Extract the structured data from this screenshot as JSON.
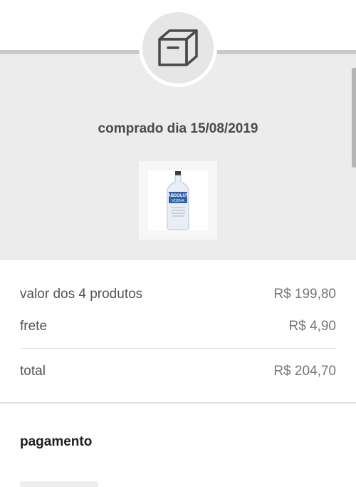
{
  "order": {
    "purchased_label": "comprado dia 15/08/2019",
    "product_image": "product-thumbnail",
    "product_brand": "ABSOLUT",
    "product_name": "VODKA"
  },
  "summary": {
    "products_label": "valor dos 4 produtos",
    "products_value": "R$ 199,80",
    "shipping_label": "frete",
    "shipping_value": "R$ 4,90",
    "total_label": "total",
    "total_value": "R$ 204,70"
  },
  "payment": {
    "title": "pagamento"
  },
  "icons": {
    "header_icon": "package-box-icon"
  },
  "colors": {
    "header_background": "#ececec",
    "icon_stroke": "#4a4a4a",
    "bottle_label": "#2f5fa8"
  }
}
